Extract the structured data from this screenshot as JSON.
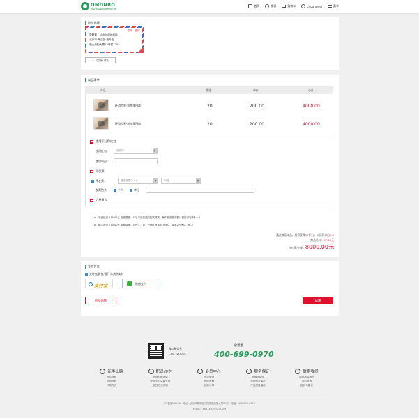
{
  "header": {
    "logo_brand": "OMONBO",
    "logo_sub": "欧蒙堡智能科技有限公司",
    "nav": [
      {
        "label": "首页",
        "icon": "home-icon"
      },
      {
        "label": "搜索",
        "icon": "search-icon"
      },
      {
        "label": "购物车",
        "icon": "cart-icon"
      },
      {
        "label": "chuangwei",
        "icon": "user-icon"
      },
      {
        "label": "菜单",
        "icon": "menu-icon"
      }
    ]
  },
  "address": {
    "section_title": "地址选择",
    "card": {
      "edit_label": "修改",
      "delete_label": "删除",
      "line1": "张莉莉　18600856656",
      "line2": "北京市·海淀区·西外街",
      "line3": "前六只街大厦12号楼1205"
    },
    "add_button": "添加新地址"
  },
  "goods": {
    "section_title": "商品清单",
    "columns": [
      "产品",
      "数量",
      "单价",
      "小计"
    ],
    "rows": [
      {
        "name": "环游世界·秋冬季围巾",
        "qty": "20",
        "price": "200.00",
        "subtotal": "4000.00"
      },
      {
        "name": "环游世界·秋冬季围巾",
        "qty": "20",
        "price": "200.00",
        "subtotal": "4000.00"
      }
    ]
  },
  "options": {
    "points_section": "使用积分和红包",
    "redpack_label": "使用红包：",
    "redpack_placeholder": "请选择",
    "points_label": "使用积分：",
    "invoice_section": "开发票",
    "invoice_label": "开发票：",
    "invoice_type": "普通发票(1%)",
    "invoice_content": "明细",
    "invoice_title_label": "发票抬头：",
    "invoice_personal": "个人",
    "invoice_company": "单位",
    "remark_section": "订单留言"
  },
  "shipping": {
    "line1": "中通速递（10.00元 免费额度：0元 中通快递的相关政策，每个费用按半额计量的)不必转......）",
    "line2": "顺丰速运（15.00元 免费额度：0元 江、浙、沪地区首重15元/KG，续重2元/KG，其...）"
  },
  "summary": {
    "line1_prefix": "通过常见成品，您将获得",
    "line1_points": "97",
    "line1_suffix": "积分，以及积分后",
    "line1_end": "9.0",
    "goods_total_label": "商品总价：",
    "goods_total": "97.00元",
    "payable_label": "应付款金额：",
    "payable": "8000.00元"
  },
  "payment": {
    "section_title": "支付方式",
    "method_label": "支付宝/微信/银行卡/其他支付",
    "alipay_label": "支付宝",
    "wechat_label": "微信支付",
    "continue_button": "继续购物",
    "settle_button": "结算"
  },
  "footer": {
    "wx_title": "微信服务号",
    "wx_id": "CIZI：VOGUE",
    "hotline_label": "欧蒙堡",
    "phone": "400-699-0970",
    "columns": [
      {
        "title": "新手上路",
        "icon": "shield-icon",
        "links": [
          "售后流程",
          "购物流程",
          "订购方式"
        ]
      },
      {
        "title": "配送/支付",
        "icon": "truck-icon",
        "links": [
          "货到付款区域",
          "配送支付智能查询",
          "支付方式说明"
        ]
      },
      {
        "title": "会员中心",
        "icon": "member-icon",
        "links": [
          "资金管理",
          "我的收藏",
          "我的订单"
        ]
      },
      {
        "title": "服务保证",
        "icon": "service-icon",
        "links": [
          "退换货原则",
          "售后服务保证",
          "产品质量保证"
        ]
      },
      {
        "title": "联系我们",
        "icon": "contact-icon",
        "links": [
          "网站故障报告",
          "选机咨询",
          "投诉与建议"
        ]
      }
    ],
    "copyright1": "ICP备案XXXXX　地址：北京市朝阳区汉阳桥路某某大厦XX号　电话：400-699-0970",
    "copyright2": "EMAIL：XXX1XXX@QQ.COM"
  },
  "colors": {
    "brand_green": "#2a9d5c",
    "price_red": "#e0102f",
    "checkbox_blue": "#3a89c9"
  }
}
